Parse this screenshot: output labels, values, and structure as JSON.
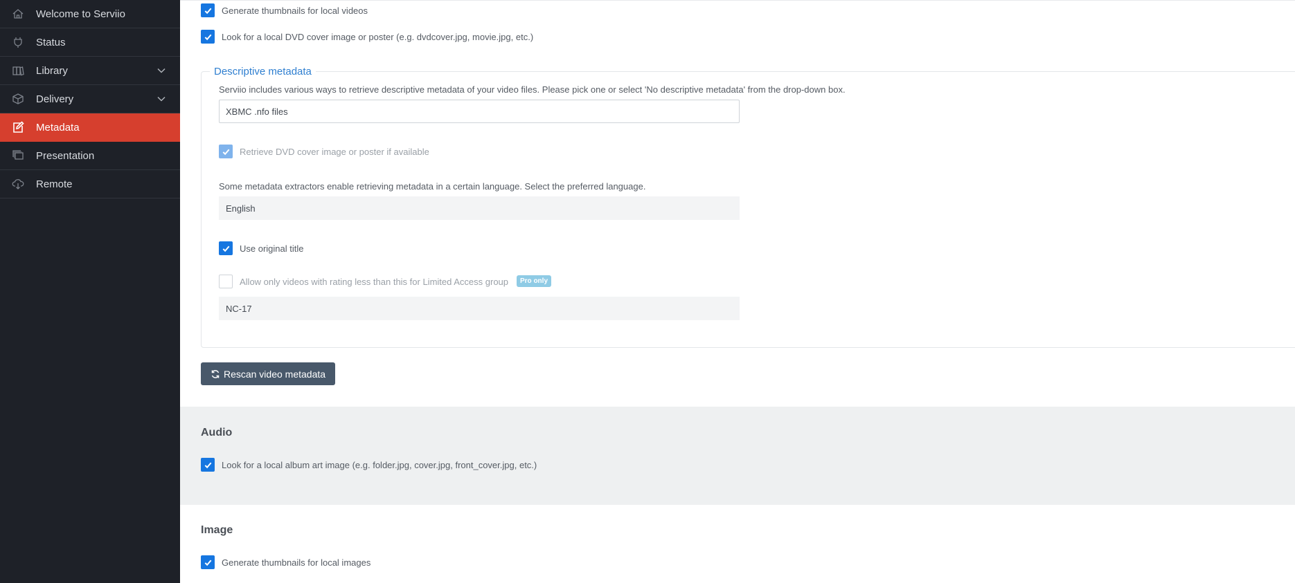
{
  "sidebar": {
    "items": [
      {
        "label": "Welcome to Serviio",
        "icon": "home-icon"
      },
      {
        "label": "Status",
        "icon": "plug-icon"
      },
      {
        "label": "Library",
        "icon": "library-icon",
        "expandable": true
      },
      {
        "label": "Delivery",
        "icon": "box-icon",
        "expandable": true
      },
      {
        "label": "Metadata",
        "icon": "edit-icon",
        "active": true
      },
      {
        "label": "Presentation",
        "icon": "presentation-icon"
      },
      {
        "label": "Remote",
        "icon": "cloud-download-icon"
      }
    ]
  },
  "video": {
    "thumbnails_label": "Generate thumbnails for local videos",
    "local_cover_label": "Look for a local DVD cover image or poster (e.g. dvdcover.jpg, movie.jpg, etc.)"
  },
  "descriptive": {
    "legend": "Descriptive metadata",
    "intro": "Serviio includes various ways to retrieve descriptive metadata of your video files. Please pick one or select 'No descriptive metadata' from the drop-down box.",
    "extractor_value": "XBMC .nfo files",
    "retrieve_cover_label": "Retrieve DVD cover image or poster if available",
    "language_intro": "Some metadata extractors enable retrieving metadata in a certain language. Select the preferred language.",
    "language_value": "English",
    "original_title_label": "Use original title",
    "rating_label": "Allow only videos with rating less than this for Limited Access group",
    "pro_badge": "Pro only",
    "rating_value": "NC-17"
  },
  "rescan_button": "Rescan video metadata",
  "audio": {
    "heading": "Audio",
    "album_art_label": "Look for a local album art image (e.g. folder.jpg, cover.jpg, front_cover.jpg, etc.)"
  },
  "image": {
    "heading": "Image",
    "thumbnails_label": "Generate thumbnails for local images"
  },
  "colors": {
    "sidebar_bg": "#1e2128",
    "active_item": "#d63f2e",
    "checkbox": "#1676e0",
    "legend": "#2f7fd0",
    "button": "#48586a",
    "badge": "#8fcbe5"
  }
}
